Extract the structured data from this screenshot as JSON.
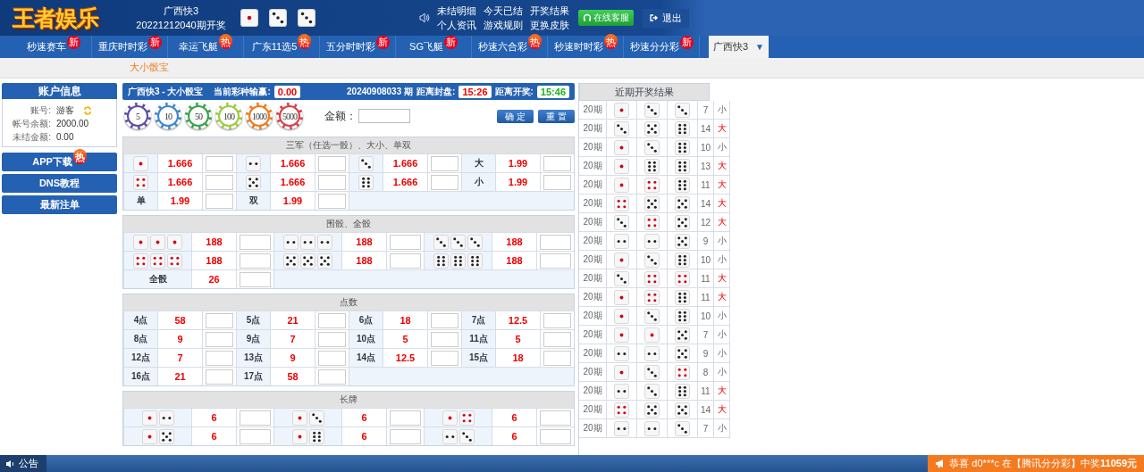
{
  "header": {
    "logo": "王者娱乐",
    "lottery": "广西快3",
    "draw": "20221212040期开奖",
    "dice": [
      {
        "kind": "one"
      },
      {
        "kind": "three"
      },
      {
        "kind": "three"
      }
    ],
    "links": [
      "未结明细",
      "今天已结",
      "开奖结果",
      "个人资讯",
      "游戏规则",
      "更换皮肤"
    ],
    "service_button": "在线客服",
    "logout_button": "退出"
  },
  "nav": [
    {
      "label": "秒速赛车",
      "badge": "新",
      "kind": "new",
      "selected": false
    },
    {
      "label": "重庆时时彩",
      "badge": "新",
      "kind": "new",
      "selected": false
    },
    {
      "label": "幸运飞艇",
      "badge": "热",
      "kind": "hot",
      "selected": false
    },
    {
      "label": "广东11选5",
      "badge": "热",
      "kind": "hot",
      "selected": false
    },
    {
      "label": "五分时时彩",
      "badge": "新",
      "kind": "new",
      "selected": false
    },
    {
      "label": "SG飞艇",
      "badge": "新",
      "kind": "new",
      "selected": false
    },
    {
      "label": "秒速六合彩",
      "badge": "热",
      "kind": "hot",
      "selected": false
    },
    {
      "label": "秒速时时彩",
      "badge": "热",
      "kind": "hot",
      "selected": false
    },
    {
      "label": "秒速分分彩",
      "badge": "新",
      "kind": "new",
      "selected": false
    },
    {
      "label": "广西快3",
      "caret": "▼",
      "selected": true
    }
  ],
  "subnav": {
    "label": "大小骰宝"
  },
  "account": {
    "title": "账户信息",
    "fields": [
      {
        "label": "账号:",
        "value": "游客",
        "refresh": true
      },
      {
        "label": "帐号余额:",
        "value": "2000.00"
      },
      {
        "label": "未结金额:",
        "value": "0.00"
      }
    ],
    "menu": [
      {
        "label": "APP下载",
        "badge": "热"
      },
      {
        "label": "DNS教程"
      },
      {
        "label": "最新注单"
      }
    ]
  },
  "bet": {
    "title": "广西快3 - 大小骰宝",
    "pnl_label": "当前彩种输赢:",
    "pnl": "0.00",
    "issue": "20240908033 期",
    "close_label": "距离封盘:",
    "close_time": "15:26",
    "draw_label": "距离开奖:",
    "draw_time": "15:46",
    "chips": [
      {
        "value": "5",
        "color": "#5b4ea6"
      },
      {
        "value": "10",
        "color": "#3f86d0"
      },
      {
        "value": "50",
        "color": "#3aa34a"
      },
      {
        "value": "100",
        "color": "#9ccc3a"
      },
      {
        "value": "1000",
        "color": "#f07a1a"
      },
      {
        "value": "5000",
        "color": "#d9404a"
      }
    ],
    "amount_label": "金额：",
    "confirm_button": "确 定",
    "reset_button": "重 置",
    "sections": [
      {
        "title": "三军（任选一骰）、大小、单双",
        "rows": [
          {
            "cells": [
              {
                "kind": "dice",
                "dice": [
                  {
                    "kind": "one"
                  }
                ],
                "odds": "1.666"
              },
              {
                "kind": "dice",
                "dice": [
                  {
                    "kind": "two"
                  }
                ],
                "odds": "1.666"
              },
              {
                "kind": "dice",
                "dice": [
                  {
                    "kind": "three"
                  }
                ],
                "odds": "1.666"
              },
              {
                "kind": "text",
                "label": "大",
                "odds": "1.99"
              }
            ]
          },
          {
            "cells": [
              {
                "kind": "dice",
                "dice": [
                  {
                    "kind": "four"
                  }
                ],
                "odds": "1.666"
              },
              {
                "kind": "dice",
                "dice": [
                  {
                    "kind": "five"
                  }
                ],
                "odds": "1.666"
              },
              {
                "kind": "dice",
                "dice": [
                  {
                    "kind": "six"
                  }
                ],
                "odds": "1.666"
              },
              {
                "kind": "text",
                "label": "小",
                "odds": "1.99"
              }
            ]
          },
          {
            "cells": [
              {
                "kind": "text",
                "label": "单",
                "odds": "1.99"
              },
              {
                "kind": "text",
                "label": "双",
                "odds": "1.99"
              }
            ]
          }
        ]
      },
      {
        "title": "围骰、全骰",
        "rows": [
          {
            "cells": [
              {
                "kind": "dice",
                "dice": [
                  {
                    "kind": "one"
                  },
                  {
                    "kind": "one"
                  },
                  {
                    "kind": "one"
                  }
                ],
                "odds": "188"
              },
              {
                "kind": "dice",
                "dice": [
                  {
                    "kind": "two"
                  },
                  {
                    "kind": "two"
                  },
                  {
                    "kind": "two"
                  }
                ],
                "odds": "188"
              },
              {
                "kind": "dice",
                "dice": [
                  {
                    "kind": "three"
                  },
                  {
                    "kind": "three"
                  },
                  {
                    "kind": "three"
                  }
                ],
                "odds": "188"
              }
            ]
          },
          {
            "cells": [
              {
                "kind": "dice",
                "dice": [
                  {
                    "kind": "four"
                  },
                  {
                    "kind": "four"
                  },
                  {
                    "kind": "four"
                  }
                ],
                "odds": "188"
              },
              {
                "kind": "dice",
                "dice": [
                  {
                    "kind": "five"
                  },
                  {
                    "kind": "five"
                  },
                  {
                    "kind": "five"
                  }
                ],
                "odds": "188"
              },
              {
                "kind": "dice",
                "dice": [
                  {
                    "kind": "six"
                  },
                  {
                    "kind": "six"
                  },
                  {
                    "kind": "six"
                  }
                ],
                "odds": "188"
              }
            ]
          },
          {
            "cells": [
              {
                "kind": "text",
                "label": "全骰",
                "odds": "26"
              }
            ]
          }
        ]
      },
      {
        "title": "点数",
        "rows": [
          {
            "cells": [
              {
                "kind": "text",
                "label": "4点",
                "odds": "58"
              },
              {
                "kind": "text",
                "label": "5点",
                "odds": "21"
              },
              {
                "kind": "text",
                "label": "6点",
                "odds": "18"
              },
              {
                "kind": "text",
                "label": "7点",
                "odds": "12.5"
              }
            ]
          },
          {
            "cells": [
              {
                "kind": "text",
                "label": "8点",
                "odds": "9"
              },
              {
                "kind": "text",
                "label": "9点",
                "odds": "7"
              },
              {
                "kind": "text",
                "label": "10点",
                "odds": "5"
              },
              {
                "kind": "text",
                "label": "11点",
                "odds": "5"
              }
            ]
          },
          {
            "cells": [
              {
                "kind": "text",
                "label": "12点",
                "odds": "7"
              },
              {
                "kind": "text",
                "label": "13点",
                "odds": "9"
              },
              {
                "kind": "text",
                "label": "14点",
                "odds": "12.5"
              },
              {
                "kind": "text",
                "label": "15点",
                "odds": "18"
              }
            ]
          },
          {
            "cells": [
              {
                "kind": "text",
                "label": "16点",
                "odds": "21"
              },
              {
                "kind": "text",
                "label": "17点",
                "odds": "58"
              }
            ]
          }
        ]
      },
      {
        "title": "长牌",
        "rows": [
          {
            "cells": [
              {
                "kind": "dice",
                "dice": [
                  {
                    "kind": "one"
                  },
                  {
                    "kind": "two"
                  }
                ],
                "odds": "6"
              },
              {
                "kind": "dice",
                "dice": [
                  {
                    "kind": "one"
                  },
                  {
                    "kind": "three"
                  }
                ],
                "odds": "6"
              },
              {
                "kind": "dice",
                "dice": [
                  {
                    "kind": "one"
                  },
                  {
                    "kind": "four"
                  }
                ],
                "odds": "6"
              }
            ]
          },
          {
            "cells": [
              {
                "kind": "dice",
                "dice": [
                  {
                    "kind": "one"
                  },
                  {
                    "kind": "five"
                  }
                ],
                "odds": "6"
              },
              {
                "kind": "dice",
                "dice": [
                  {
                    "kind": "one"
                  },
                  {
                    "kind": "six"
                  }
                ],
                "odds": "6"
              },
              {
                "kind": "dice",
                "dice": [
                  {
                    "kind": "two"
                  },
                  {
                    "kind": "three"
                  }
                ],
                "odds": "6"
              }
            ]
          }
        ]
      }
    ]
  },
  "results": {
    "title": "近期开奖结果",
    "rows": [
      {
        "issue": "20期",
        "dice": [
          {
            "kind": "one"
          },
          {
            "kind": "three"
          },
          {
            "kind": "three"
          }
        ],
        "sum": "7",
        "size": "小",
        "big": false
      },
      {
        "issue": "20期",
        "dice": [
          {
            "kind": "three"
          },
          {
            "kind": "five"
          },
          {
            "kind": "six"
          }
        ],
        "sum": "14",
        "size": "大",
        "big": true
      },
      {
        "issue": "20期",
        "dice": [
          {
            "kind": "one"
          },
          {
            "kind": "three"
          },
          {
            "kind": "six"
          }
        ],
        "sum": "10",
        "size": "小",
        "big": false
      },
      {
        "issue": "20期",
        "dice": [
          {
            "kind": "one"
          },
          {
            "kind": "six"
          },
          {
            "kind": "six"
          }
        ],
        "sum": "13",
        "size": "大",
        "big": true
      },
      {
        "issue": "20期",
        "dice": [
          {
            "kind": "one"
          },
          {
            "kind": "four"
          },
          {
            "kind": "six"
          }
        ],
        "sum": "11",
        "size": "大",
        "big": true
      },
      {
        "issue": "20期",
        "dice": [
          {
            "kind": "four"
          },
          {
            "kind": "five"
          },
          {
            "kind": "five"
          }
        ],
        "sum": "14",
        "size": "大",
        "big": true
      },
      {
        "issue": "20期",
        "dice": [
          {
            "kind": "three"
          },
          {
            "kind": "four"
          },
          {
            "kind": "five"
          }
        ],
        "sum": "12",
        "size": "大",
        "big": true
      },
      {
        "issue": "20期",
        "dice": [
          {
            "kind": "two"
          },
          {
            "kind": "two"
          },
          {
            "kind": "five"
          }
        ],
        "sum": "9",
        "size": "小",
        "big": false
      },
      {
        "issue": "20期",
        "dice": [
          {
            "kind": "one"
          },
          {
            "kind": "three"
          },
          {
            "kind": "six"
          }
        ],
        "sum": "10",
        "size": "小",
        "big": false
      },
      {
        "issue": "20期",
        "dice": [
          {
            "kind": "three"
          },
          {
            "kind": "four"
          },
          {
            "kind": "four"
          }
        ],
        "sum": "11",
        "size": "大",
        "big": true
      },
      {
        "issue": "20期",
        "dice": [
          {
            "kind": "one"
          },
          {
            "kind": "four"
          },
          {
            "kind": "six"
          }
        ],
        "sum": "11",
        "size": "大",
        "big": true
      },
      {
        "issue": "20期",
        "dice": [
          {
            "kind": "one"
          },
          {
            "kind": "three"
          },
          {
            "kind": "six"
          }
        ],
        "sum": "10",
        "size": "小",
        "big": false
      },
      {
        "issue": "20期",
        "dice": [
          {
            "kind": "one"
          },
          {
            "kind": "one"
          },
          {
            "kind": "five"
          }
        ],
        "sum": "7",
        "size": "小",
        "big": false
      },
      {
        "issue": "20期",
        "dice": [
          {
            "kind": "two"
          },
          {
            "kind": "two"
          },
          {
            "kind": "five"
          }
        ],
        "sum": "9",
        "size": "小",
        "big": false
      },
      {
        "issue": "20期",
        "dice": [
          {
            "kind": "one"
          },
          {
            "kind": "three"
          },
          {
            "kind": "four"
          }
        ],
        "sum": "8",
        "size": "小",
        "big": false
      },
      {
        "issue": "20期",
        "dice": [
          {
            "kind": "two"
          },
          {
            "kind": "three"
          },
          {
            "kind": "six"
          }
        ],
        "sum": "11",
        "size": "大",
        "big": true
      },
      {
        "issue": "20期",
        "dice": [
          {
            "kind": "four"
          },
          {
            "kind": "five"
          },
          {
            "kind": "five"
          }
        ],
        "sum": "14",
        "size": "大",
        "big": true
      },
      {
        "issue": "20期",
        "dice": [
          {
            "kind": "two"
          },
          {
            "kind": "two"
          },
          {
            "kind": "three"
          }
        ],
        "sum": "7",
        "size": "小",
        "big": false
      }
    ]
  },
  "footer": {
    "notice": "公告",
    "ticker": "恭喜 d0***c 在【腾讯分分彩】中奖",
    "prize": "11059元"
  }
}
